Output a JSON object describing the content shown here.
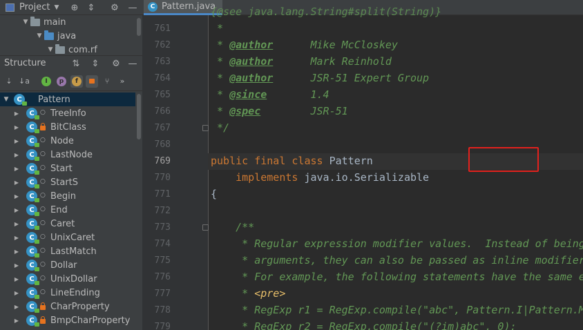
{
  "project_panel": {
    "title": "Project",
    "tree": [
      {
        "label": "main",
        "type": "folder"
      },
      {
        "label": "java",
        "type": "source-folder"
      },
      {
        "label": "com.rf",
        "type": "package"
      }
    ]
  },
  "structure_panel": {
    "title": "Structure",
    "root": "Pattern",
    "items": [
      {
        "label": "TreeInfo",
        "visibility": "package"
      },
      {
        "label": "BitClass",
        "visibility": "private"
      },
      {
        "label": "Node",
        "visibility": "package"
      },
      {
        "label": "LastNode",
        "visibility": "package"
      },
      {
        "label": "Start",
        "visibility": "package"
      },
      {
        "label": "StartS",
        "visibility": "package"
      },
      {
        "label": "Begin",
        "visibility": "package"
      },
      {
        "label": "End",
        "visibility": "package"
      },
      {
        "label": "Caret",
        "visibility": "package"
      },
      {
        "label": "UnixCaret",
        "visibility": "package"
      },
      {
        "label": "LastMatch",
        "visibility": "package"
      },
      {
        "label": "Dollar",
        "visibility": "package"
      },
      {
        "label": "UnixDollar",
        "visibility": "package"
      },
      {
        "label": "LineEnding",
        "visibility": "package"
      },
      {
        "label": "CharProperty",
        "visibility": "private"
      },
      {
        "label": "BmpCharProperty",
        "visibility": "private"
      }
    ],
    "filter_icons": [
      "f",
      "p",
      "lock"
    ]
  },
  "editor": {
    "tab_label": "Pattern.java",
    "current_line": "769",
    "lines": [
      {
        "no": "761",
        "text": " *"
      },
      {
        "no": "762",
        "text": " * @author      Mike McCloskey"
      },
      {
        "no": "763",
        "text": " * @author      Mark Reinhold"
      },
      {
        "no": "764",
        "text": " * @author      JSR-51 Expert Group"
      },
      {
        "no": "765",
        "text": " * @since       1.4"
      },
      {
        "no": "766",
        "text": " * @spec        JSR-51"
      },
      {
        "no": "767",
        "text": " */"
      },
      {
        "no": "768",
        "text": ""
      },
      {
        "no": "769",
        "text": "public final class Pattern"
      },
      {
        "no": "770",
        "text": "    implements java.io.Serializable"
      },
      {
        "no": "771",
        "text": "{"
      },
      {
        "no": "772",
        "text": ""
      },
      {
        "no": "773",
        "text": "    /**"
      },
      {
        "no": "774",
        "text": "     * Regular expression modifier values.  Instead of being"
      },
      {
        "no": "775",
        "text": "     * arguments, they can also be passed as inline modifier"
      },
      {
        "no": "776",
        "text": "     * For example, the following statements have the same e"
      },
      {
        "no": "777",
        "text": "     * <pre>"
      },
      {
        "no": "778",
        "text": "     * RegExp r1 = RegExp.compile(\"abc\", Pattern.I|Pattern.M"
      },
      {
        "no": "779",
        "text": "     * RegExp r2 = RegExp.compile(\"(?im)abc\", 0);"
      }
    ],
    "partial_top_line": "{@see java.lang.String#split(String)}",
    "highlighted_token": "Pattern"
  },
  "colors": {
    "keyword": "#cc7832",
    "doc_comment": "#629755",
    "highlight_box": "#e3211d",
    "class_icon": "#3592c4"
  }
}
